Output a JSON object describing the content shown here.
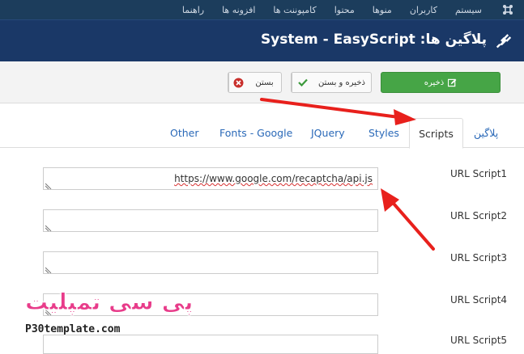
{
  "topnav": {
    "items": [
      "سیستم",
      "کاربران",
      "منوها",
      "محتوا",
      "کامپوننت ها",
      "افزونه ها",
      "راهنما"
    ]
  },
  "header": {
    "title": "پلاگین ها: System - EasyScript"
  },
  "toolbar": {
    "save_label": "ذخیره",
    "save_close_label": "ذخیره و بستن",
    "close_label": "بستن"
  },
  "tabs": [
    {
      "label": "پلاگین"
    },
    {
      "label": "Scripts"
    },
    {
      "label": "Styles"
    },
    {
      "label": "JQuery"
    },
    {
      "label": "Fonts - Google"
    },
    {
      "label": "Other"
    }
  ],
  "active_tab": "Scripts",
  "form": {
    "rows": [
      {
        "label": "URL Script1",
        "value": "https://www.google.com/recaptcha/api.js"
      },
      {
        "label": "URL Script2",
        "value": ""
      },
      {
        "label": "URL Script3",
        "value": ""
      },
      {
        "label": "URL Script4",
        "value": ""
      },
      {
        "label": "URL Script5",
        "value": ""
      }
    ]
  },
  "watermark": {
    "brand": "پی سی تمپلیت",
    "site": "P30template.com"
  },
  "colors": {
    "topnav_bg": "#1c3d5c",
    "header_bg": "#1a3867",
    "save_green": "#46a546",
    "close_red": "#c9302c",
    "link_blue": "#2a69b8",
    "arrow_red": "#e8201c"
  },
  "icons": {
    "joomla": "joomla-logo-icon",
    "plugin": "plug-icon",
    "save": "edit-icon",
    "save_close": "check-icon",
    "close": "cancel-circle-icon"
  }
}
